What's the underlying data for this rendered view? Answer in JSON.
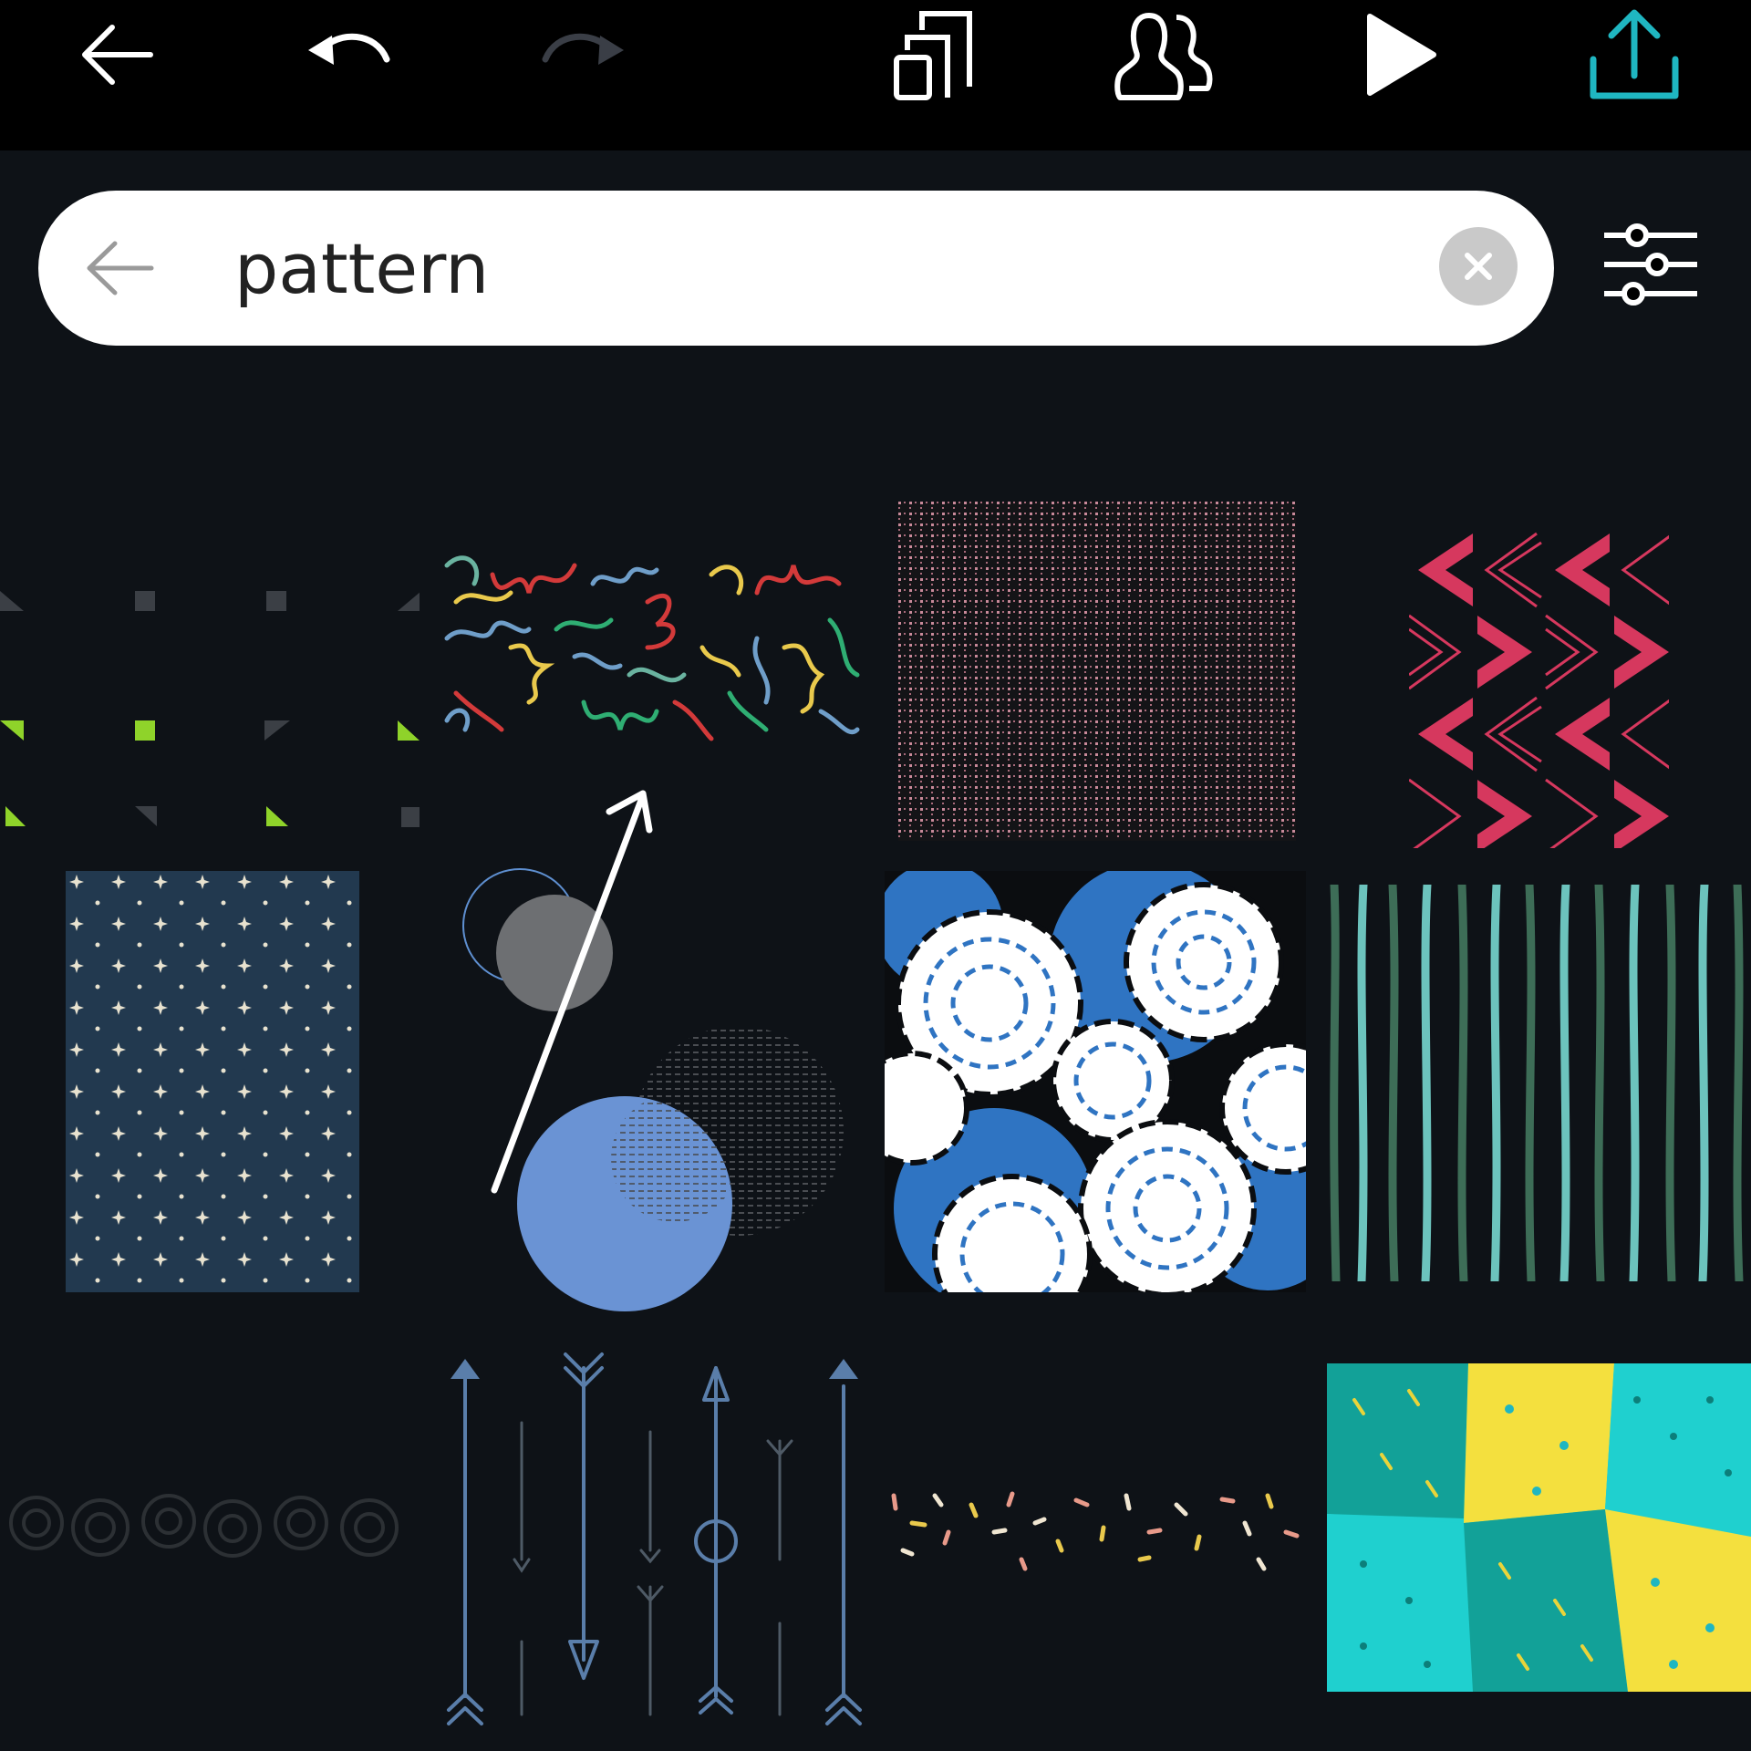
{
  "toolbar": {
    "back_icon": "arrow-left-icon",
    "undo_icon": "undo-icon",
    "redo_icon": "redo-icon",
    "pages_icon": "pages-stack-icon",
    "share_people_icon": "people-icon",
    "present_icon": "play-icon",
    "export_icon": "upload-icon"
  },
  "search": {
    "value": "pattern",
    "back_icon": "arrow-left-icon",
    "clear_icon": "close-icon",
    "filter_icon": "sliders-icon"
  },
  "colors": {
    "background": "#0e1217",
    "topbar": "#000000",
    "accent": "#1fb6c1"
  },
  "results": [
    {
      "pattern": "geometric-triangles"
    },
    {
      "pattern": "colorful-squiggles"
    },
    {
      "pattern": "pink-grid"
    },
    {
      "pattern": "pink-chevrons"
    },
    {
      "pattern": "stars-on-navy"
    },
    {
      "pattern": "circles-abstract"
    },
    {
      "pattern": "blue-white-rings"
    },
    {
      "pattern": "green-stripes"
    },
    {
      "pattern": "dark-floral"
    },
    {
      "pattern": "tribal-arrows"
    },
    {
      "pattern": "confetti-sprinkles"
    },
    {
      "pattern": "teal-yellow-patchwork"
    }
  ]
}
